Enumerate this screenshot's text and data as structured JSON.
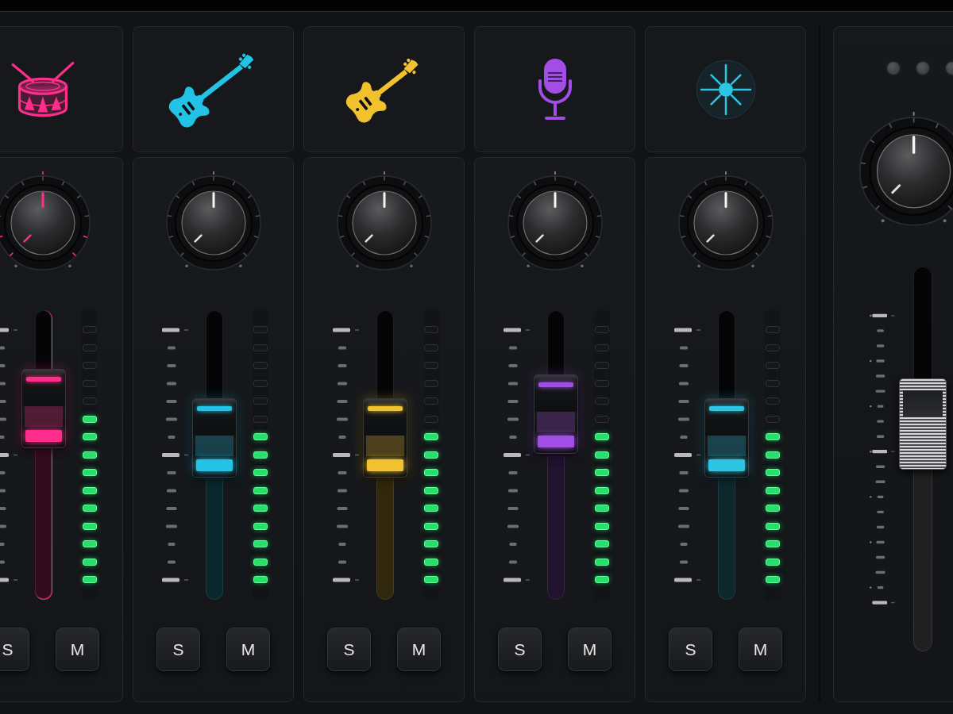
{
  "channels": [
    {
      "kind": "drums",
      "color": "#ff2e8c",
      "selected": true,
      "knob": {
        "level": 0.5
      },
      "fader": {
        "level": 0.66
      },
      "meter": {
        "level": 0.67
      },
      "buttons": [
        "S",
        "M"
      ]
    },
    {
      "kind": "bass",
      "color": "#22c3e6",
      "selected": false,
      "knob": {
        "level": 0.5
      },
      "fader": {
        "level": 0.56
      },
      "meter": {
        "level": 0.6
      },
      "buttons": [
        "S",
        "M"
      ]
    },
    {
      "kind": "guitar",
      "color": "#f2c12e",
      "selected": false,
      "knob": {
        "level": 0.5
      },
      "fader": {
        "level": 0.56
      },
      "meter": {
        "level": 0.6
      },
      "buttons": [
        "S",
        "M"
      ]
    },
    {
      "kind": "mic",
      "color": "#a24ee6",
      "selected": false,
      "knob": {
        "level": 0.5
      },
      "fader": {
        "level": 0.64
      },
      "meter": {
        "level": 0.6
      },
      "buttons": [
        "S",
        "M"
      ]
    },
    {
      "kind": "burst",
      "color": "#2cc6e4",
      "selected": false,
      "knob": {
        "level": 0.5
      },
      "fader": {
        "level": 0.56
      },
      "meter": {
        "level": 0.6
      },
      "buttons": [
        "S",
        "M"
      ]
    }
  ],
  "master": {
    "knob": {
      "level": 0.5
    },
    "fader": {
      "level": 0.59
    }
  }
}
